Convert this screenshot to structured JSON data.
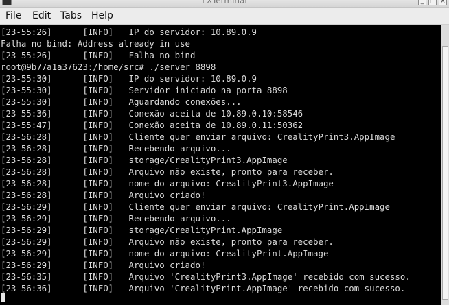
{
  "window": {
    "title": "LXTerminal",
    "controls": {
      "minimize": "_",
      "maximize": "□",
      "close": "×"
    }
  },
  "menubar": {
    "items": [
      "File",
      "Edit",
      "Tabs",
      "Help"
    ]
  },
  "terminal": {
    "lines": [
      "[23-55:26]      [INFO]   IP do servidor: 10.89.0.9",
      "Falha no bind: Address already in use",
      "[23-55:26]      [INFO]   Falha no bind",
      "root@9b77a1a37623:/home/src# ./server 8898",
      "[23-55:30]      [INFO]   IP do servidor: 10.89.0.9",
      "[23-55:30]      [INFO]   Servidor iniciado na porta 8898",
      "[23-55:30]      [INFO]   Aguardando conexões...",
      "[23-55:36]      [INFO]   Conexão aceita de 10.89.0.10:58546",
      "[23-55:47]      [INFO]   Conexão aceita de 10.89.0.11:50362",
      "[23-56:28]      [INFO]   Cliente quer enviar arquivo: CrealityPrint3.AppImage",
      "[23-56:28]      [INFO]   Recebendo arquivo...",
      "[23-56:28]      [INFO]   storage/CrealityPrint3.AppImage",
      "[23-56:28]      [INFO]   Arquivo não existe, pronto para receber.",
      "[23-56:28]      [INFO]   nome do arquivo: CrealityPrint3.AppImage",
      "[23-56:28]      [INFO]   Arquivo criado!",
      "[23-56:29]      [INFO]   Cliente quer enviar arquivo: CrealityPrint.AppImage",
      "[23-56:29]      [INFO]   Recebendo arquivo...",
      "[23-56:29]      [INFO]   storage/CrealityPrint.AppImage",
      "[23-56:29]      [INFO]   Arquivo não existe, pronto para receber.",
      "[23-56:29]      [INFO]   nome do arquivo: CrealityPrint.AppImage",
      "[23-56:29]      [INFO]   Arquivo criado!",
      "[23-56:35]      [INFO]   Arquivo 'CrealityPrint3.AppImage' recebido com sucesso.",
      "[23-56:36]      [INFO]   Arquivo 'CrealityPrint.AppImage' recebido com sucesso."
    ],
    "colors": {
      "background": "#000000",
      "foreground": "#d9d9d9",
      "cursor": "#e8e8e8"
    }
  }
}
